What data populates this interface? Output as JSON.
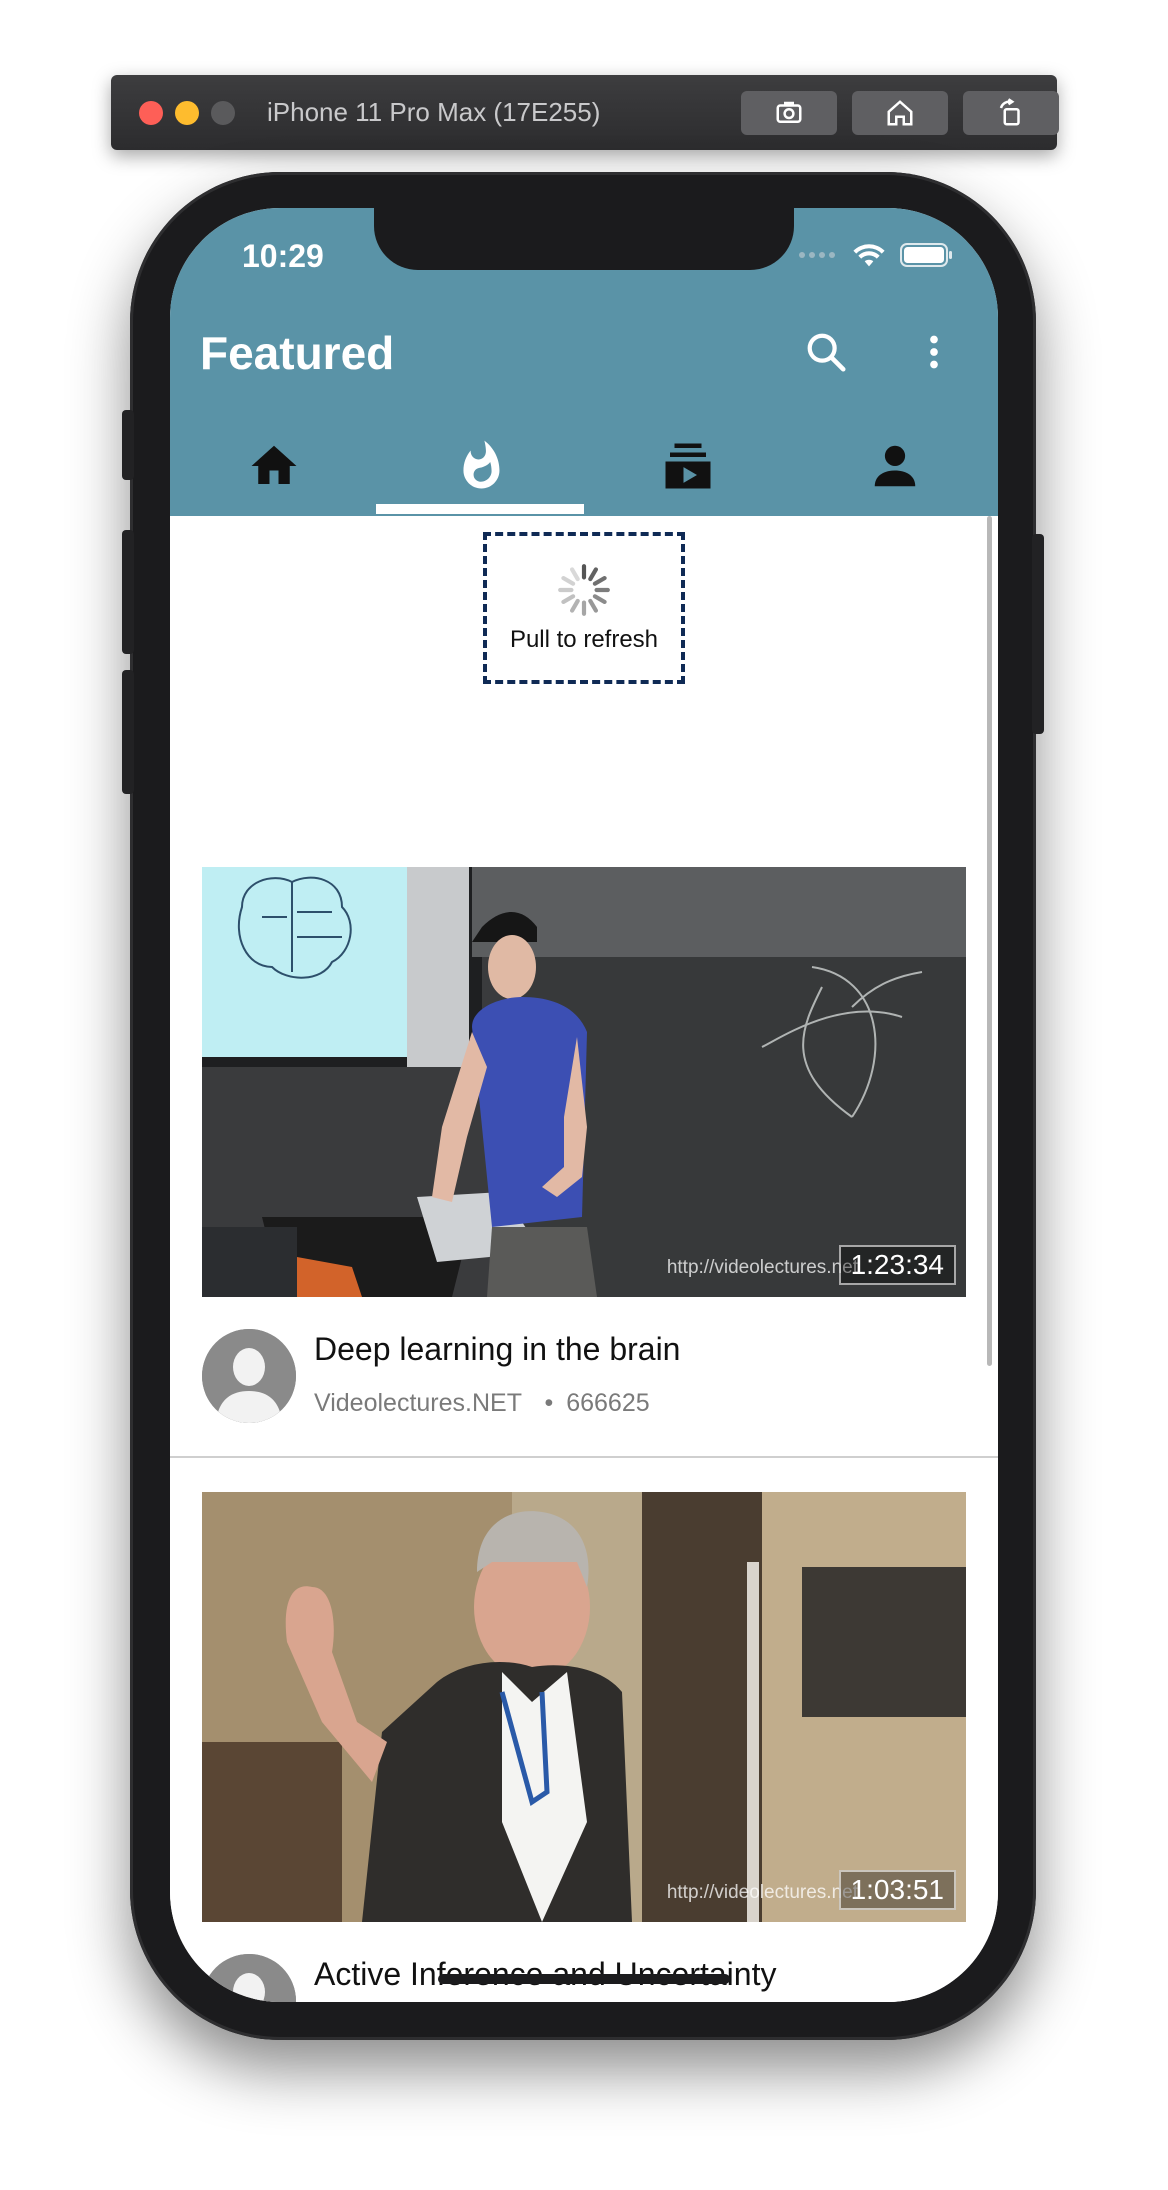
{
  "simulator": {
    "title": "iPhone 11 Pro Max (17E255)",
    "buttons": [
      "screenshot-icon",
      "home-icon",
      "rotate-icon"
    ]
  },
  "status_bar": {
    "time": "10:29"
  },
  "app_bar": {
    "title": "Featured",
    "actions": [
      "search-icon",
      "more-vert-icon"
    ],
    "color": "#5a93a7"
  },
  "tabs": [
    {
      "icon": "home-icon",
      "selected": false
    },
    {
      "icon": "fire-icon",
      "selected": true
    },
    {
      "icon": "subscriptions-icon",
      "selected": false
    },
    {
      "icon": "person-icon",
      "selected": false
    }
  ],
  "refresh": {
    "label": "Pull to refresh"
  },
  "videos": [
    {
      "title": "Deep learning in the brain",
      "channel": "Videolectures.NET",
      "views": "666625",
      "duration": "1:23:34",
      "watermark": "http://videolectures.net"
    },
    {
      "title": "Active Inference and Uncertainty",
      "channel": "",
      "views": "",
      "duration": "1:03:51",
      "watermark": "http://videolectures.net"
    }
  ],
  "separator": "•"
}
